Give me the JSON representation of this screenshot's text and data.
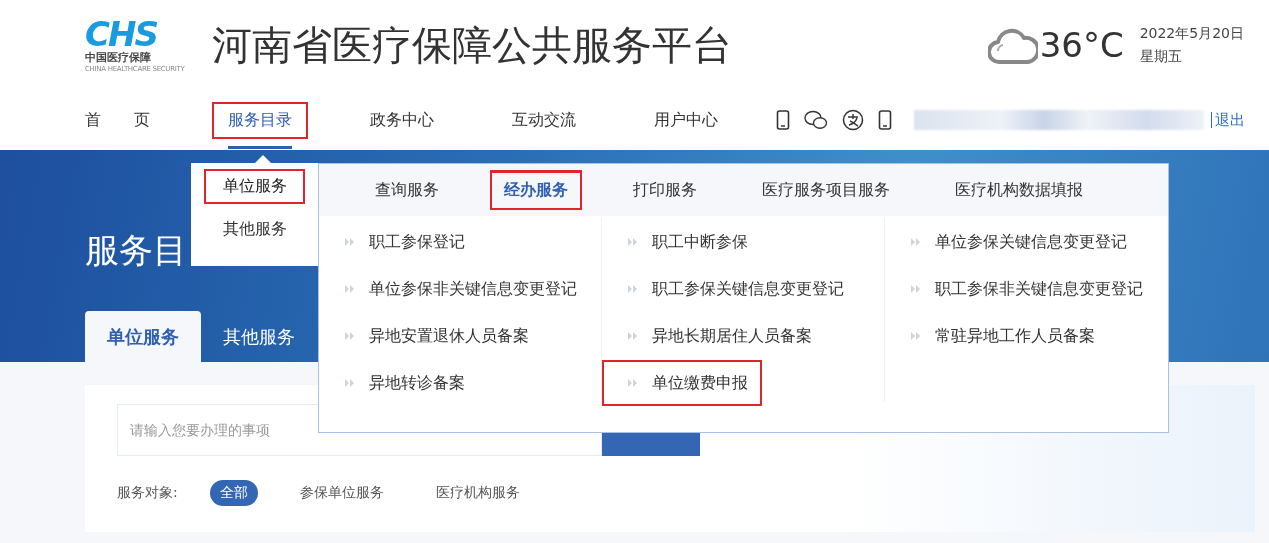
{
  "header": {
    "logo": {
      "mark": "CHS",
      "caption": "中国医疗保障",
      "tagline": "CHINA HEALTHCARE SECURITY"
    },
    "title": "河南省医疗保障公共服务平台",
    "weather": {
      "temperature": "36°C",
      "date": "2022年5月20日",
      "weekday": "星期五"
    }
  },
  "nav": {
    "items": [
      {
        "label": "首 页",
        "selected": false,
        "highlighted": false
      },
      {
        "label": "服务目录",
        "selected": true,
        "highlighted": true
      },
      {
        "label": "政务中心",
        "selected": false,
        "highlighted": false
      },
      {
        "label": "互动交流",
        "selected": false,
        "highlighted": false
      },
      {
        "label": "用户中心",
        "selected": false,
        "highlighted": false
      }
    ],
    "logout": "退出"
  },
  "banner": {
    "heading": "服务目",
    "tabs": [
      {
        "label": "单位服务",
        "selected": true
      },
      {
        "label": "其他服务",
        "selected": false
      }
    ]
  },
  "search": {
    "placeholder": "请输入您要办理的事项"
  },
  "filter": {
    "label": "服务对象:",
    "options": [
      {
        "label": "全部",
        "selected": true
      },
      {
        "label": "参保单位服务",
        "selected": false
      },
      {
        "label": "医疗机构服务",
        "selected": false
      }
    ]
  },
  "menu": {
    "groups": [
      {
        "label": "单位服务",
        "selected": true,
        "highlighted": true
      },
      {
        "label": "其他服务",
        "selected": false,
        "highlighted": false
      }
    ],
    "tabs": [
      {
        "label": "查询服务",
        "selected": false,
        "highlighted": false
      },
      {
        "label": "经办服务",
        "selected": true,
        "highlighted": true
      },
      {
        "label": "打印服务",
        "selected": false,
        "highlighted": false
      },
      {
        "label": "医疗服务项目服务",
        "selected": false,
        "highlighted": false
      },
      {
        "label": "医疗机构数据填报",
        "selected": false,
        "highlighted": false
      }
    ],
    "columns": [
      [
        {
          "label": "职工参保登记",
          "highlighted": false
        },
        {
          "label": "单位参保非关键信息变更登记",
          "highlighted": false
        },
        {
          "label": "异地安置退休人员备案",
          "highlighted": false
        },
        {
          "label": "异地转诊备案",
          "highlighted": false
        }
      ],
      [
        {
          "label": "职工中断参保",
          "highlighted": false
        },
        {
          "label": "职工参保关键信息变更登记",
          "highlighted": false
        },
        {
          "label": "异地长期居住人员备案",
          "highlighted": false
        },
        {
          "label": "单位缴费申报",
          "highlighted": true
        }
      ],
      [
        {
          "label": "单位参保关键信息变更登记",
          "highlighted": false
        },
        {
          "label": "职工参保非关键信息变更登记",
          "highlighted": false
        },
        {
          "label": "常驻异地工作人员备案",
          "highlighted": false
        }
      ]
    ]
  }
}
